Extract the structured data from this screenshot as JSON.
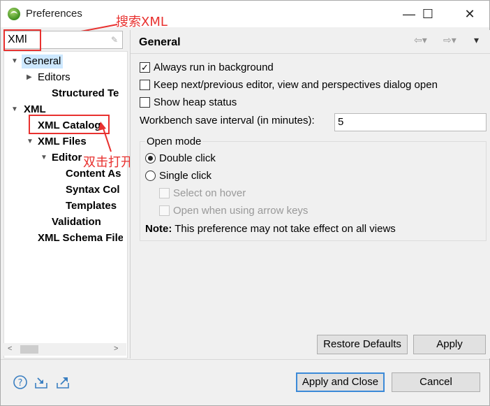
{
  "window": {
    "title": "Preferences",
    "minimize": "—",
    "maximize": "☐",
    "close": "✕"
  },
  "annotations": {
    "search_note": "搜索XML",
    "open_note": "双击打开"
  },
  "filter": {
    "value": "XMl"
  },
  "tree": [
    {
      "label": "General",
      "twisty": "▼",
      "bold": false,
      "selected": true
    },
    {
      "label": "Editors",
      "twisty": "▶",
      "bold": false
    },
    {
      "label": "Structured Te",
      "twisty": "",
      "bold": true
    },
    {
      "label": "XML",
      "twisty": "▼",
      "bold": true
    },
    {
      "label": "XML Catalog",
      "twisty": "",
      "bold": true
    },
    {
      "label": "XML Files",
      "twisty": "▼",
      "bold": true
    },
    {
      "label": "Editor",
      "twisty": "▼",
      "bold": true
    },
    {
      "label": "Content As",
      "twisty": "",
      "bold": true
    },
    {
      "label": "Syntax Col",
      "twisty": "",
      "bold": true
    },
    {
      "label": "Templates",
      "twisty": "",
      "bold": true
    },
    {
      "label": "Validation",
      "twisty": "",
      "bold": true
    },
    {
      "label": "XML Schema File",
      "twisty": "",
      "bold": true
    }
  ],
  "page": {
    "title": "General",
    "options": [
      {
        "label": "Always run in background",
        "checked": true,
        "mark": "✓"
      },
      {
        "label": "Keep next/previous editor, view and perspectives dialog open",
        "checked": false,
        "mark": ""
      },
      {
        "label": "Show heap status",
        "checked": false,
        "mark": ""
      }
    ],
    "save_interval_label": "Workbench save interval (in minutes):",
    "save_interval_value": "5",
    "open_mode": {
      "title": "Open mode",
      "double_click": "Double click",
      "single_click": "Single click",
      "select_on_hover": "Select on hover",
      "open_arrow_keys": "Open when using arrow keys"
    },
    "note_bold": "Note:",
    "note_text": " This preference may not take effect on all views"
  },
  "buttons": {
    "restore_defaults": "Restore Defaults",
    "apply": "Apply",
    "apply_close": "Apply and Close",
    "cancel": "Cancel"
  },
  "icons": {
    "help": "help-icon",
    "import": "import-icon",
    "export": "export-icon",
    "back": "back-arrow-icon",
    "forward": "forward-arrow-icon",
    "menu": "view-menu-icon"
  }
}
